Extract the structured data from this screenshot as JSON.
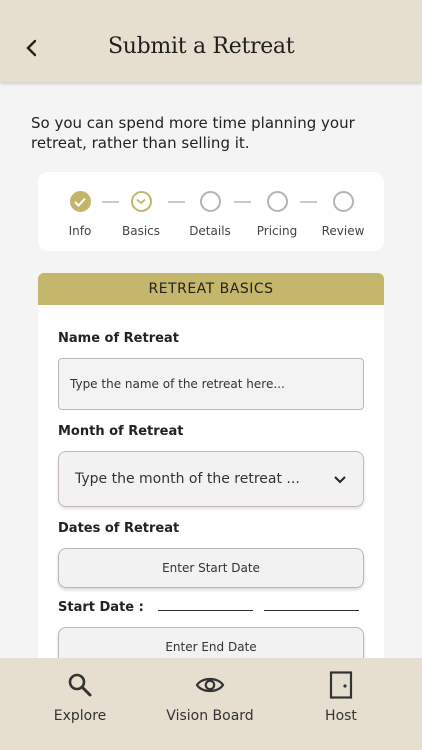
{
  "header": {
    "title": "Submit a Retreat"
  },
  "intro": "So you can spend more time planning your retreat, rather than selling it.",
  "stepper": {
    "steps": [
      {
        "label": "Info",
        "state": "done"
      },
      {
        "label": "Basics",
        "state": "active"
      },
      {
        "label": "Details",
        "state": "pending"
      },
      {
        "label": "Pricing",
        "state": "pending"
      },
      {
        "label": "Review",
        "state": "pending"
      }
    ]
  },
  "form": {
    "section_title": "RETREAT BASICS",
    "name_label": "Name of Retreat",
    "name_placeholder": "Type the name of the retreat here...",
    "month_label": "Month of Retreat",
    "month_placeholder": "Type the month of the retreat ...",
    "dates_label": "Dates of Retreat",
    "start_button": "Enter Start Date",
    "start_date_label": "Start Date :",
    "end_button": "Enter End Date"
  },
  "tabbar": {
    "items": [
      {
        "label": "Explore",
        "icon": "search-icon"
      },
      {
        "label": "Vision Board",
        "icon": "eye-icon"
      },
      {
        "label": "Host",
        "icon": "door-icon"
      }
    ]
  },
  "colors": {
    "accent": "#c4b76c",
    "header_bg": "#e6dfd0"
  }
}
